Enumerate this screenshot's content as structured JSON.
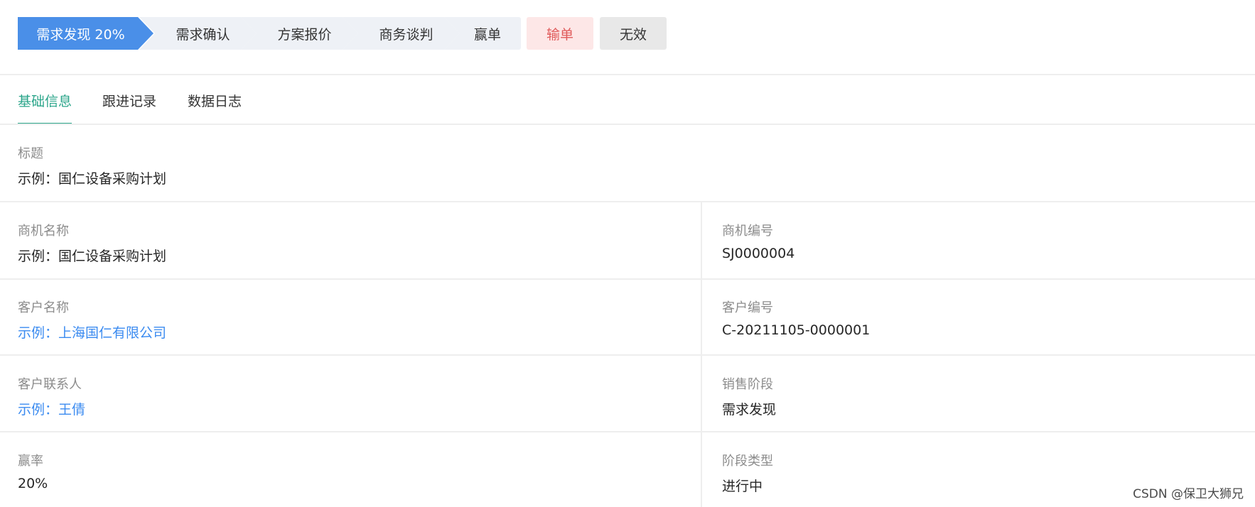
{
  "colors": {
    "active_stage": "#4a8fe8",
    "lose_bg": "#fde7e7",
    "lose_text": "#e05a5a",
    "invalid_bg": "#e8e8e8",
    "tab_accent": "#2ba58a",
    "link": "#3b8bf0"
  },
  "stages": [
    {
      "label": "需求发现 20%",
      "active": true
    },
    {
      "label": "需求确认"
    },
    {
      "label": "方案报价"
    },
    {
      "label": "商务谈判"
    },
    {
      "label": "赢单"
    },
    {
      "label": "输单"
    },
    {
      "label": "无效"
    }
  ],
  "tabs": [
    {
      "label": "基础信息",
      "active": true
    },
    {
      "label": "跟进记录"
    },
    {
      "label": "数据日志"
    }
  ],
  "fields": {
    "title": {
      "label": "标题",
      "value": "示例：国仁设备采购计划"
    },
    "opportunity_name": {
      "label": "商机名称",
      "value": "示例：国仁设备采购计划"
    },
    "opportunity_no": {
      "label": "商机编号",
      "value": "SJ0000004"
    },
    "customer_name": {
      "label": "客户名称",
      "value": "示例：上海国仁有限公司"
    },
    "customer_no": {
      "label": "客户编号",
      "value": "C-20211105-0000001"
    },
    "customer_contact": {
      "label": "客户联系人",
      "value": "示例：王倩"
    },
    "sales_stage": {
      "label": "销售阶段",
      "value": "需求发现"
    },
    "win_rate": {
      "label": "赢率",
      "value": "20%"
    },
    "stage_type": {
      "label": "阶段类型",
      "value": "进行中"
    }
  },
  "watermark": "CSDN @保卫大狮兄"
}
